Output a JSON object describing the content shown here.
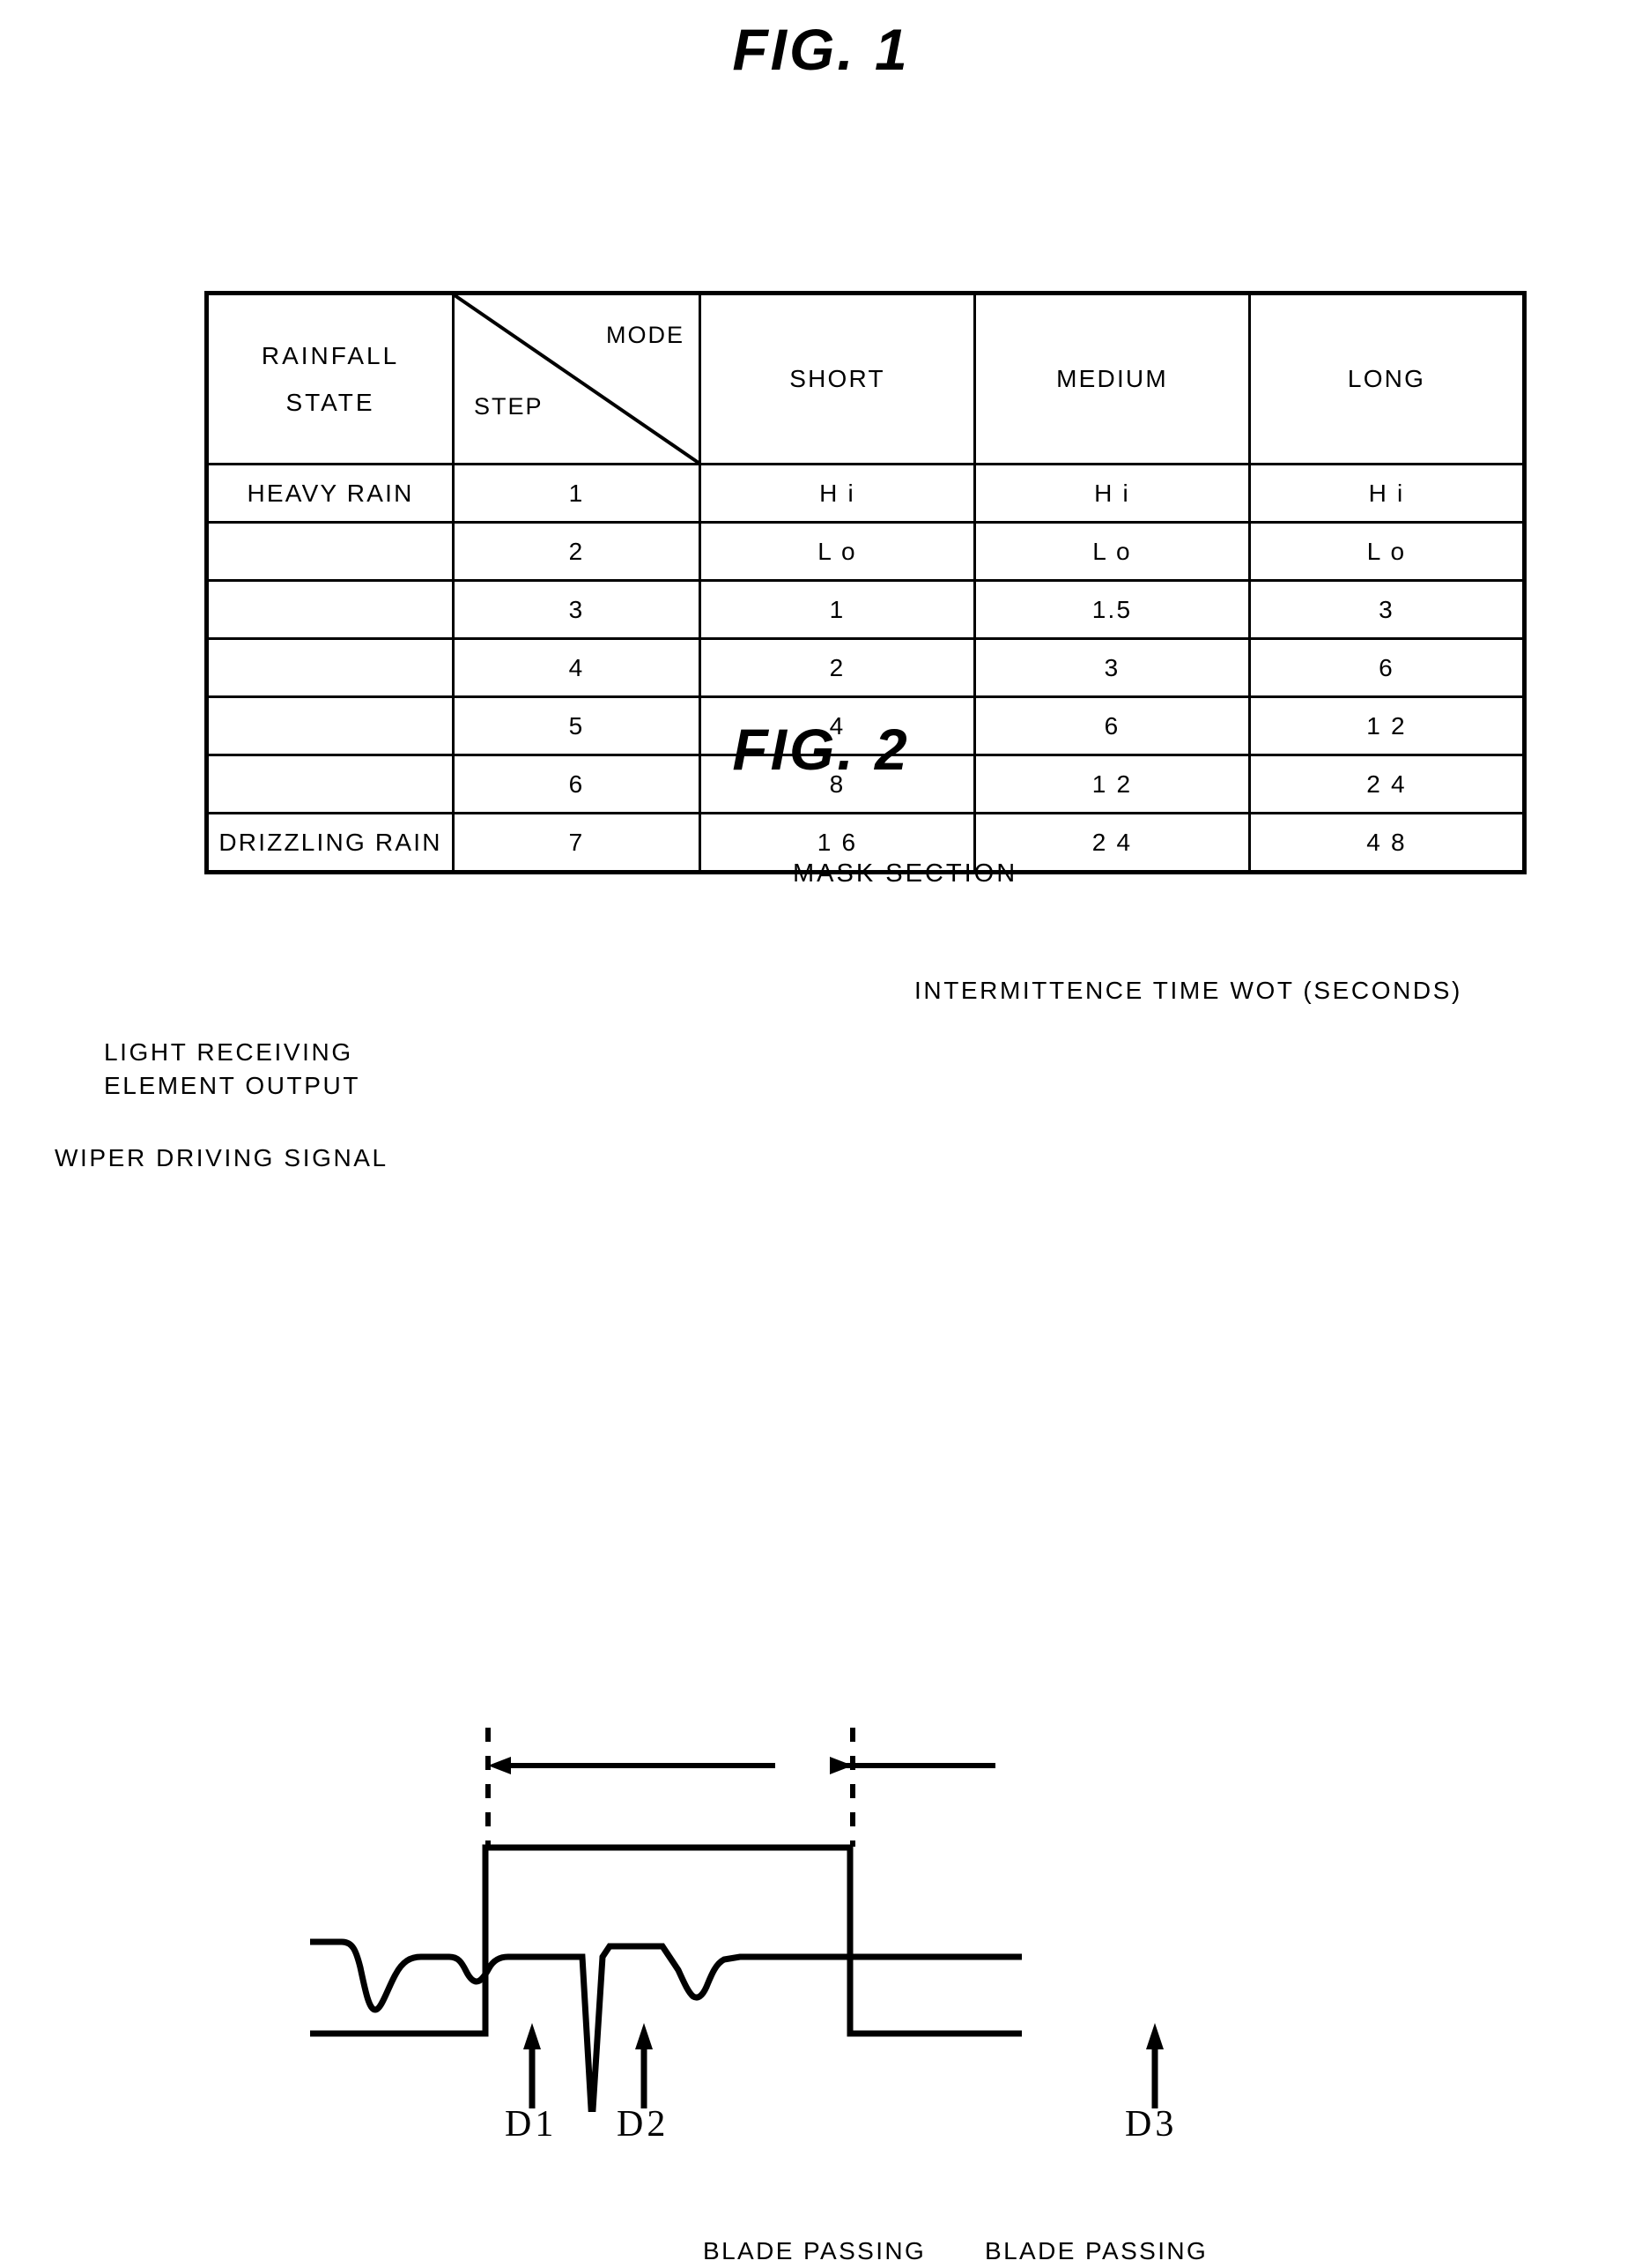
{
  "figures": {
    "fig1": {
      "title": "FIG. 1",
      "caption": "INTERMITTENCE TIME WOT (SECONDS)",
      "table": {
        "corner": {
          "state_line1": "RAINFALL",
          "state_line2": "STATE",
          "mode_label": "MODE",
          "step_label": "STEP"
        },
        "columns": [
          "SHORT",
          "MEDIUM",
          "LONG"
        ],
        "rows": [
          {
            "state": "HEAVY RAIN",
            "step": "1",
            "short": "H i",
            "medium": "H i",
            "long": "H i"
          },
          {
            "state": "",
            "step": "2",
            "short": "L o",
            "medium": "L o",
            "long": "L o"
          },
          {
            "state": "",
            "step": "3",
            "short": "1",
            "medium": "1.5",
            "long": "3"
          },
          {
            "state": "",
            "step": "4",
            "short": "2",
            "medium": "3",
            "long": "6"
          },
          {
            "state": "",
            "step": "5",
            "short": "4",
            "medium": "6",
            "long": "1 2"
          },
          {
            "state": "",
            "step": "6",
            "short": "8",
            "medium": "1 2",
            "long": "2 4"
          },
          {
            "state": "DRIZZLING RAIN",
            "step": "7",
            "short": "1 6",
            "medium": "2 4",
            "long": "4 8"
          }
        ]
      }
    },
    "fig2": {
      "title": "FIG. 2",
      "mask_section_label": "MASK SECTION",
      "signal_labels": {
        "light_line1": "LIGHT RECEIVING",
        "light_line2": "ELEMENT OUTPUT",
        "wiper": "WIPER DRIVING SIGNAL"
      },
      "annotations": {
        "d1": "D1",
        "d2": "D2",
        "d3": "D3",
        "blade_passing_1": "BLADE PASSING",
        "blade_passing_2": "BLADE PASSING"
      }
    }
  },
  "colors": {
    "ink": "#000000",
    "paper": "#ffffff"
  }
}
